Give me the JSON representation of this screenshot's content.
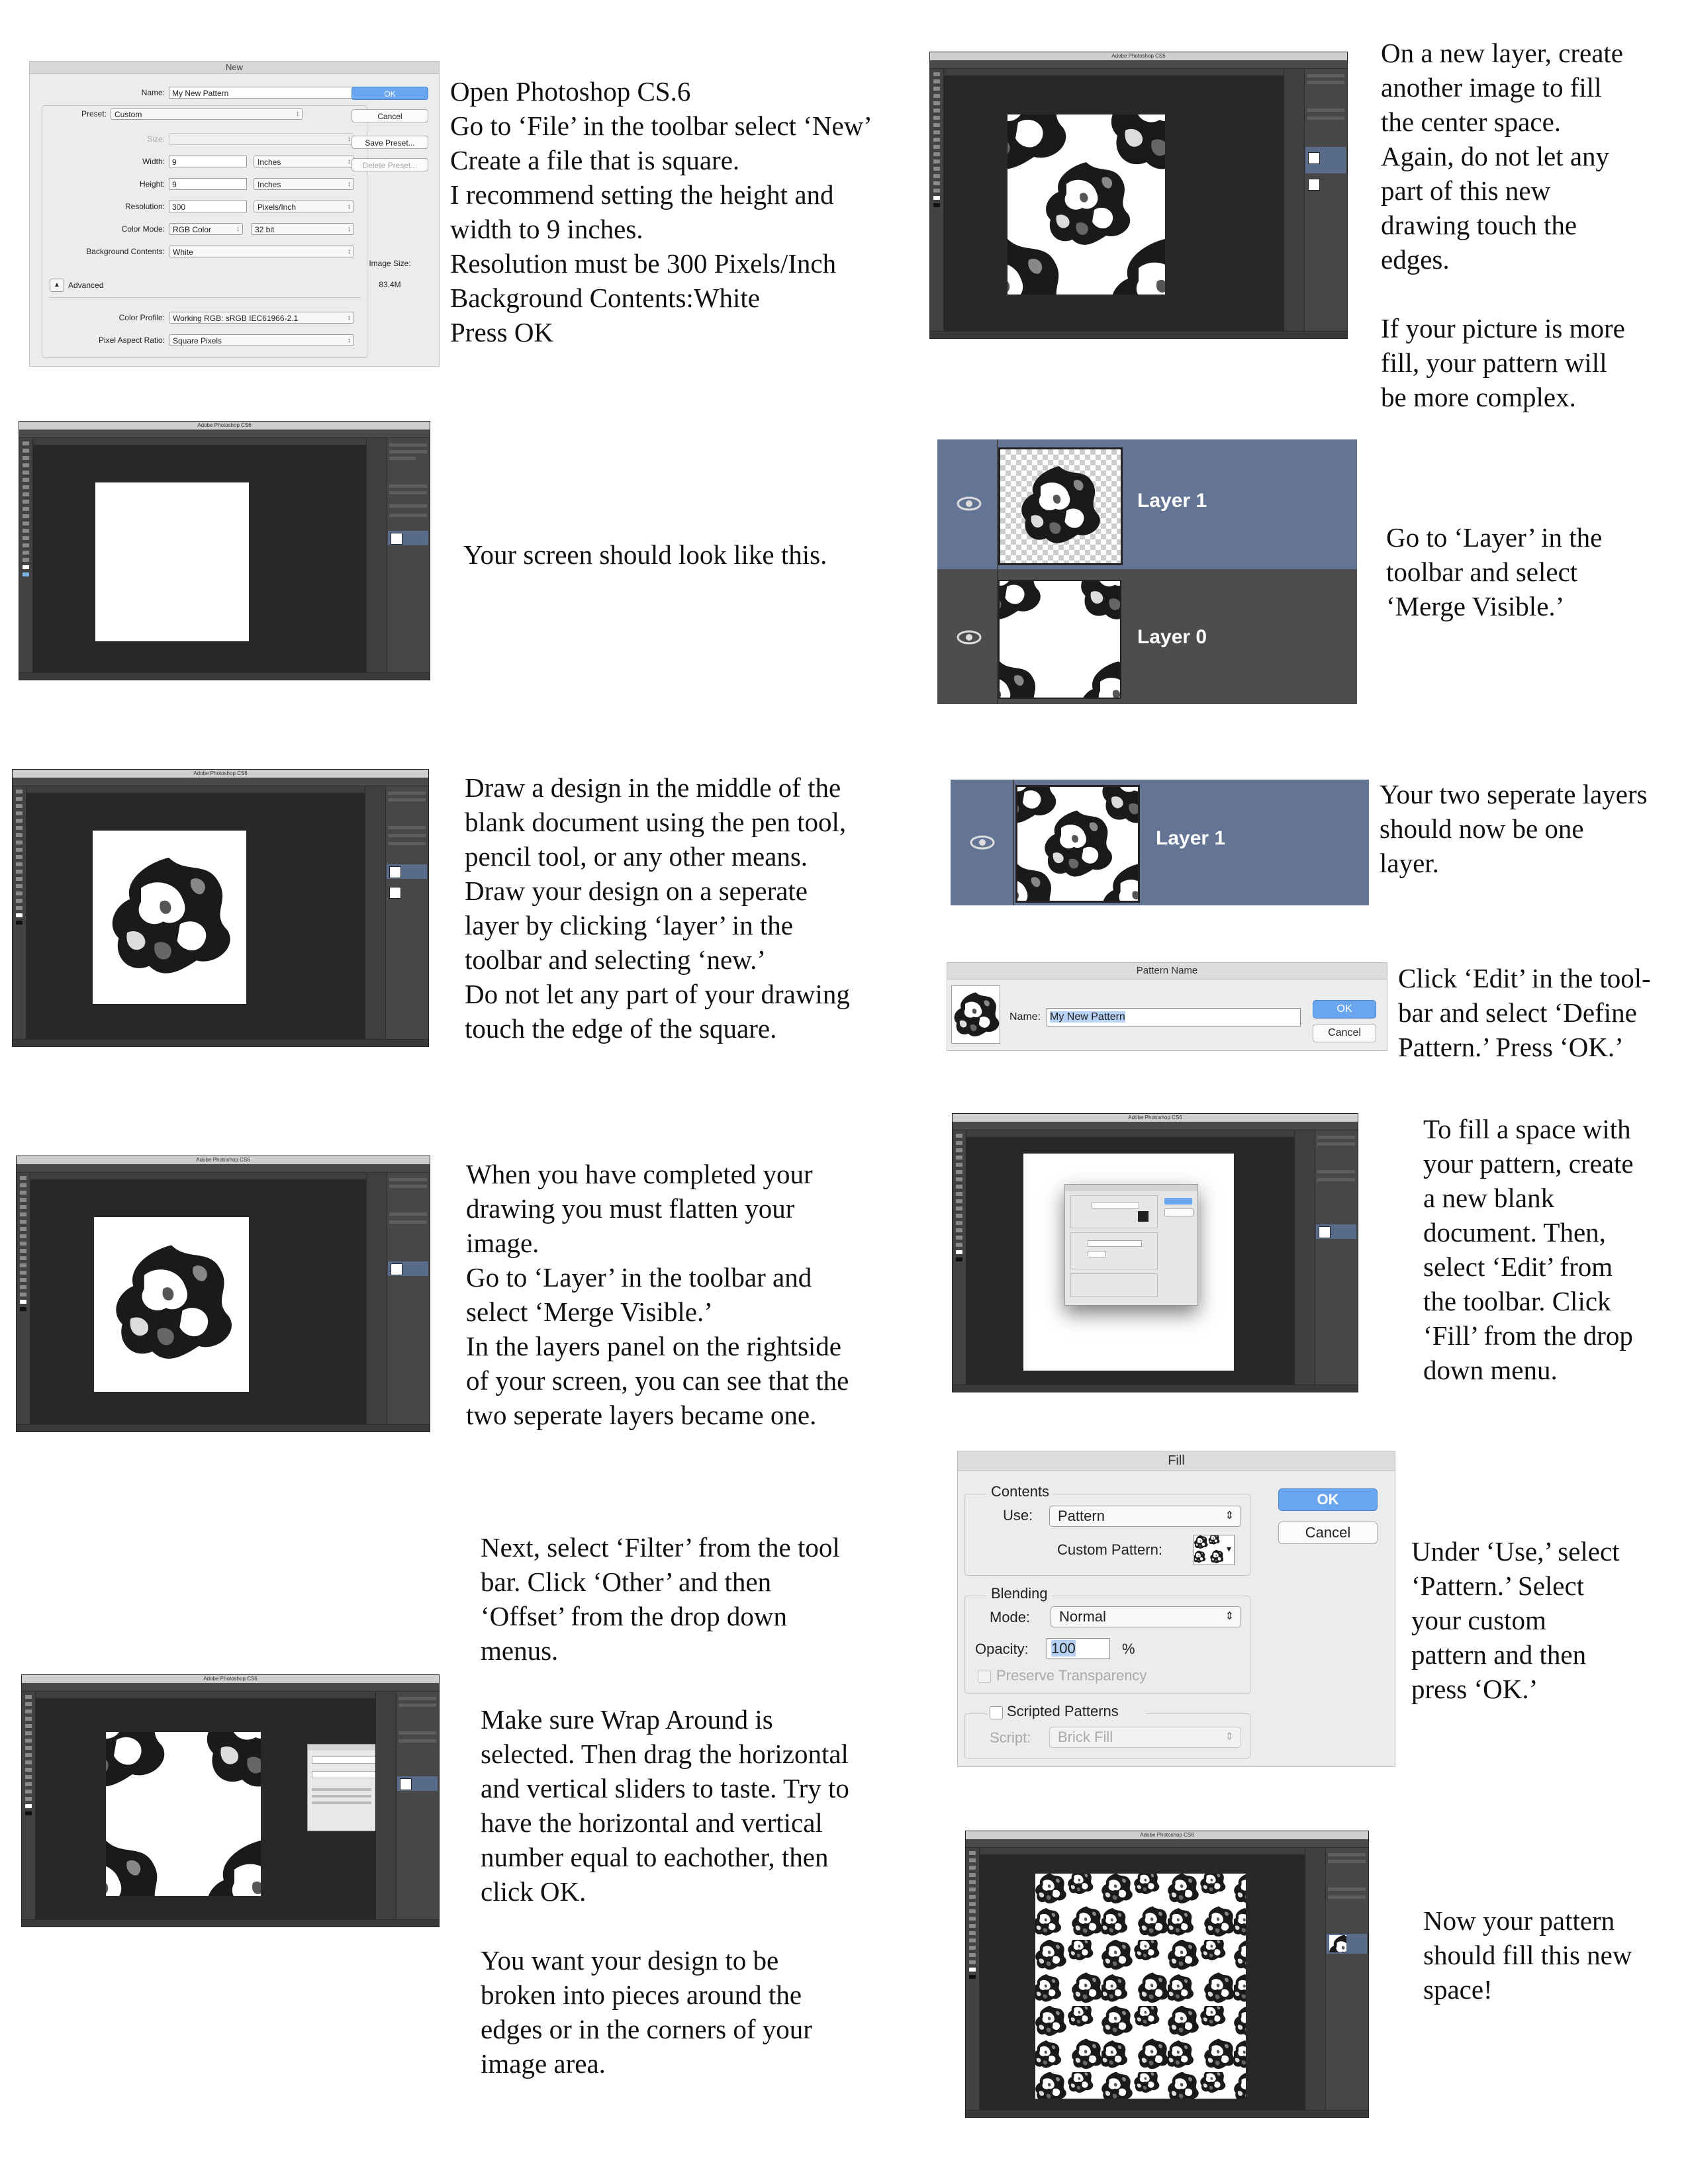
{
  "steps": {
    "s1": [
      "Open Photoshop CS.6",
      "Go to ‘File’ in the toolbar select ‘New’",
      "Create a file that is square.",
      "I recommend setting the height and",
      "width to 9 inches.",
      "Resolution must be 300 Pixels/Inch",
      "Background Contents:White",
      "Press OK"
    ],
    "s2": [
      "Your screen should look like this."
    ],
    "s3": [
      "Draw a design in the middle of the",
      "blank document using the pen tool,",
      "pencil tool, or any other means.",
      "Draw your design on a seperate",
      "layer by clicking ‘layer’ in the",
      "toolbar and selecting ‘new.’",
      "Do not let any part of your drawing",
      "touch the edge of the square."
    ],
    "s4": [
      "When you have completed your",
      "drawing you must flatten your",
      "image.",
      "Go to ‘Layer’ in the toolbar and",
      "select ‘Merge Visible.’",
      "In the layers panel on the rightside",
      "of your screen, you can see that the",
      "two seperate layers became one."
    ],
    "s5a": [
      "Next, select ‘Filter’ from the tool",
      "bar. Click ‘Other’ and then",
      "‘Offset’ from the drop down",
      "menus."
    ],
    "s5b": [
      "Make sure Wrap Around is",
      "selected. Then drag the horizontal",
      "and vertical sliders to taste. Try to",
      "have the horizontal and vertical",
      "number equal to eachother, then",
      "click OK."
    ],
    "s5c": [
      "You want your design to be",
      "broken into pieces around the",
      "edges or in the corners of your",
      "image area."
    ],
    "s6a": [
      "On a new layer, create",
      "another image to fill",
      "the center space.",
      "Again, do not let any",
      "part of this new",
      "drawing touch the",
      "edges."
    ],
    "s6b": [
      "If your picture is more",
      "fill, your pattern will",
      "be more complex."
    ],
    "s7": [
      "Go to ‘Layer’ in the",
      "toolbar and select",
      "‘Merge Visible.’"
    ],
    "s8": [
      "Your two seperate layers",
      " should now be one",
      "layer."
    ],
    "s9": [
      "Click ‘Edit’ in the tool-",
      "bar and select ‘Define",
      "Pattern.’ Press ‘OK.’"
    ],
    "s10": [
      "To fill a space with",
      "your pattern, create",
      "a new blank",
      "document. Then,",
      "select ‘Edit’ from",
      "the toolbar. Click",
      "‘Fill’ from the drop",
      "down menu."
    ],
    "s11": [
      "Under ‘Use,’ select",
      "‘Pattern.’ Select",
      "your custom",
      "pattern and then",
      "press ‘OK.’"
    ],
    "s12": [
      "Now your pattern",
      "should fill this new",
      "space!"
    ]
  },
  "app_title": "Adobe Photoshop CS6",
  "new_dialog": {
    "title": "New",
    "name_label": "Name:",
    "name_value": "My New Pattern",
    "preset_label": "Preset:",
    "preset_value": "Custom",
    "size_label": "Size:",
    "width_label": "Width:",
    "width_value": "9",
    "width_unit": "Inches",
    "height_label": "Height:",
    "height_value": "9",
    "height_unit": "Inches",
    "resolution_label": "Resolution:",
    "resolution_value": "300",
    "resolution_unit": "Pixels/Inch",
    "color_mode_label": "Color Mode:",
    "color_mode_value": "RGB Color",
    "bit_depth": "32 bit",
    "bg_label": "Background Contents:",
    "bg_value": "White",
    "advanced_label": "Advanced",
    "profile_label": "Color Profile:",
    "profile_value": "Working RGB:  sRGB IEC61966-2.1",
    "aspect_label": "Pixel Aspect Ratio:",
    "aspect_value": "Square Pixels",
    "ok": "OK",
    "cancel": "Cancel",
    "save_preset": "Save Preset...",
    "delete_preset": "Delete Preset...",
    "image_size_label": "Image Size:",
    "image_size_value": "83.4M"
  },
  "layers": {
    "layer1": "Layer 1",
    "layer0": "Layer 0"
  },
  "pattern_dialog": {
    "title": "Pattern Name",
    "name_label": "Name:",
    "name_value": "My New Pattern",
    "ok": "OK",
    "cancel": "Cancel"
  },
  "fill_dialog": {
    "title": "Fill",
    "contents_label": "Contents",
    "use_label": "Use:",
    "use_value": "Pattern",
    "custom_pattern_label": "Custom Pattern:",
    "blending_label": "Blending",
    "mode_label": "Mode:",
    "mode_value": "Normal",
    "opacity_label": "Opacity:",
    "opacity_value": "100",
    "opacity_unit": "%",
    "preserve_label": "Preserve Transparency",
    "scripted_label": "Scripted Patterns",
    "script_label": "Script:",
    "script_value": "Brick Fill",
    "ok": "OK",
    "cancel": "Cancel"
  },
  "colors": {
    "layer_selected": "#637494",
    "ps_dark": "#282828",
    "ok_blue": "#6aa5f0"
  }
}
